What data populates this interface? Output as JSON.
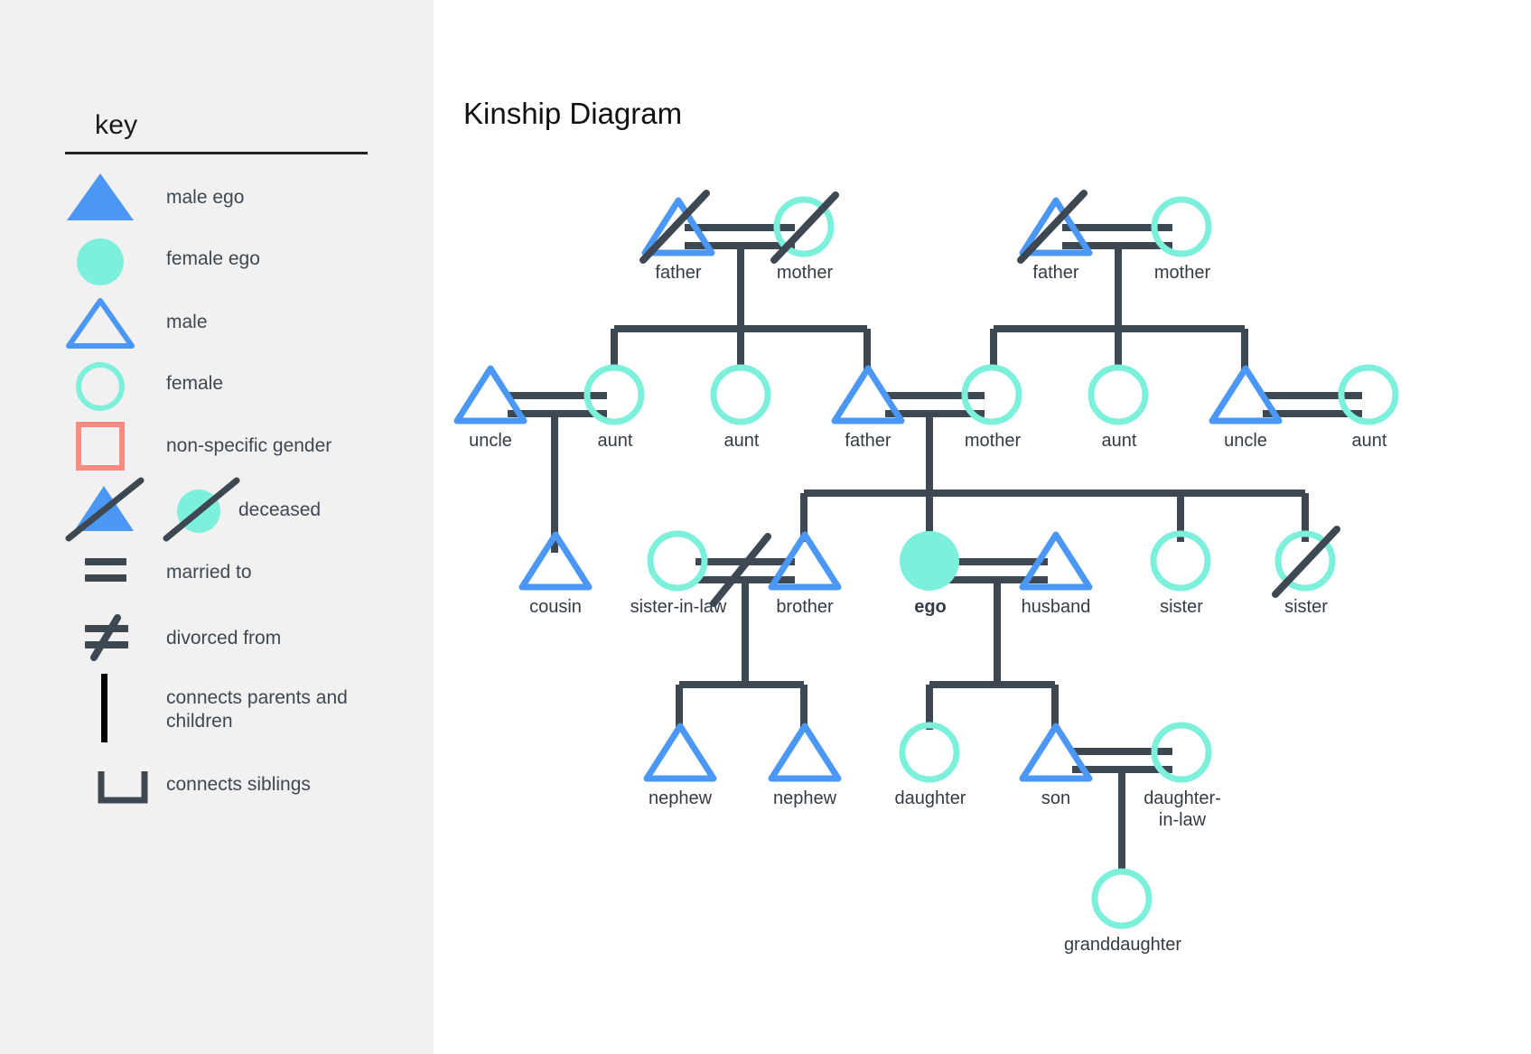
{
  "key": {
    "title": "key",
    "items": [
      {
        "icon": "filled-triangle-icon",
        "label": "male ego"
      },
      {
        "icon": "filled-circle-icon",
        "label": "female ego"
      },
      {
        "icon": "outline-triangle-icon",
        "label": "male"
      },
      {
        "icon": "outline-circle-icon",
        "label": "female"
      },
      {
        "icon": "outline-square-icon",
        "label": "non-specific gender"
      },
      {
        "icon": "slashed-shapes-icon",
        "label": "deceased"
      },
      {
        "icon": "equals-icon",
        "label": "married to"
      },
      {
        "icon": "not-equals-icon",
        "label": "divorced from"
      },
      {
        "icon": "vertical-line-icon",
        "label": "connects parents and children"
      },
      {
        "icon": "sibling-bracket-icon",
        "label": "connects siblings"
      }
    ]
  },
  "diagram": {
    "title": "Kinship Diagram",
    "nodes": [
      {
        "id": "gp1-father",
        "label": "father",
        "shape": "triangle",
        "fill": "outline",
        "deceased": true
      },
      {
        "id": "gp1-mother",
        "label": "mother",
        "shape": "circle",
        "fill": "outline",
        "deceased": true
      },
      {
        "id": "gp2-father",
        "label": "father",
        "shape": "triangle",
        "fill": "outline",
        "deceased": true
      },
      {
        "id": "gp2-mother",
        "label": "mother",
        "shape": "circle",
        "fill": "outline",
        "deceased": false
      },
      {
        "id": "uncle-left",
        "label": "uncle",
        "shape": "triangle",
        "fill": "outline",
        "deceased": false
      },
      {
        "id": "aunt-left-1",
        "label": "aunt",
        "shape": "circle",
        "fill": "outline",
        "deceased": false
      },
      {
        "id": "aunt-left-2",
        "label": "aunt",
        "shape": "circle",
        "fill": "outline",
        "deceased": false
      },
      {
        "id": "father",
        "label": "father",
        "shape": "triangle",
        "fill": "outline",
        "deceased": false
      },
      {
        "id": "mother",
        "label": "mother",
        "shape": "circle",
        "fill": "outline",
        "deceased": false
      },
      {
        "id": "aunt-right-1",
        "label": "aunt",
        "shape": "circle",
        "fill": "outline",
        "deceased": false
      },
      {
        "id": "uncle-right",
        "label": "uncle",
        "shape": "triangle",
        "fill": "outline",
        "deceased": false
      },
      {
        "id": "aunt-right-2",
        "label": "aunt",
        "shape": "circle",
        "fill": "outline",
        "deceased": false
      },
      {
        "id": "cousin",
        "label": "cousin",
        "shape": "triangle",
        "fill": "outline",
        "deceased": false
      },
      {
        "id": "sister-in-law",
        "label": "sister-in-law",
        "shape": "circle",
        "fill": "outline",
        "deceased": false
      },
      {
        "id": "brother",
        "label": "brother",
        "shape": "triangle",
        "fill": "outline",
        "deceased": false
      },
      {
        "id": "ego",
        "label": "ego",
        "shape": "circle",
        "fill": "solid",
        "deceased": false
      },
      {
        "id": "husband",
        "label": "husband",
        "shape": "triangle",
        "fill": "outline",
        "deceased": false
      },
      {
        "id": "sister-1",
        "label": "sister",
        "shape": "circle",
        "fill": "outline",
        "deceased": false
      },
      {
        "id": "sister-2",
        "label": "sister",
        "shape": "circle",
        "fill": "outline",
        "deceased": true
      },
      {
        "id": "nephew-1",
        "label": "nephew",
        "shape": "triangle",
        "fill": "outline",
        "deceased": false
      },
      {
        "id": "nephew-2",
        "label": "nephew",
        "shape": "triangle",
        "fill": "outline",
        "deceased": false
      },
      {
        "id": "daughter",
        "label": "daughter",
        "shape": "circle",
        "fill": "outline",
        "deceased": false
      },
      {
        "id": "son",
        "label": "son",
        "shape": "triangle",
        "fill": "outline",
        "deceased": false
      },
      {
        "id": "daughter-in-law",
        "label": "daughter-\nin-law",
        "shape": "circle",
        "fill": "outline",
        "deceased": false
      },
      {
        "id": "granddaughter",
        "label": "granddaughter",
        "shape": "circle",
        "fill": "outline",
        "deceased": false
      }
    ]
  },
  "colors": {
    "male": "#4a97f5",
    "female": "#7df0dc",
    "nonspecific": "#fa8a82",
    "line": "#3d4852",
    "panel_bg": "#f1f1f1",
    "text": "#333c45"
  }
}
